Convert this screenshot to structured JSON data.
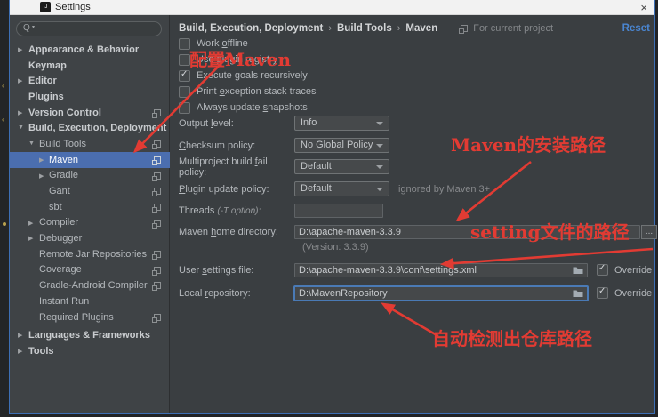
{
  "window": {
    "title": "Settings",
    "close_glyph": "×",
    "app_icon_text": "IJ"
  },
  "search": {
    "icon": "Q",
    "caret": "▾"
  },
  "sidebar": {
    "items": [
      {
        "arrow": "▶",
        "label": "Appearance & Behavior"
      },
      {
        "arrow": "",
        "label": "Keymap"
      },
      {
        "arrow": "▶",
        "label": "Editor"
      },
      {
        "arrow": "",
        "label": "Plugins"
      },
      {
        "arrow": "▶",
        "label": "Version Control"
      },
      {
        "arrow": "▼",
        "label": "Build, Execution, Deployment"
      },
      {
        "arrow": "▼",
        "label": "Build Tools"
      },
      {
        "arrow": "▶",
        "label": "Maven"
      },
      {
        "arrow": "▶",
        "label": "Gradle"
      },
      {
        "arrow": "",
        "label": "Gant"
      },
      {
        "arrow": "",
        "label": "sbt"
      },
      {
        "arrow": "▶",
        "label": "Compiler"
      },
      {
        "arrow": "▶",
        "label": "Debugger"
      },
      {
        "arrow": "",
        "label": "Remote Jar Repositories"
      },
      {
        "arrow": "",
        "label": "Coverage"
      },
      {
        "arrow": "",
        "label": "Gradle-Android Compiler"
      },
      {
        "arrow": "",
        "label": "Instant Run"
      },
      {
        "arrow": "",
        "label": "Required Plugins"
      },
      {
        "arrow": "▶",
        "label": "Languages & Frameworks"
      },
      {
        "arrow": "▶",
        "label": "Tools"
      }
    ]
  },
  "breadcrumb": {
    "seg1": "Build, Execution, Deployment",
    "seg2": "Build Tools",
    "seg3": "Maven",
    "separator": "›",
    "scope_label": "For current project",
    "reset_label": "Reset"
  },
  "checkboxes": [
    {
      "pre": "Work ",
      "u": "o",
      "post": "ffline",
      "check": ""
    },
    {
      "pre": "Use plugin registry",
      "u": "",
      "post": "",
      "check": ""
    },
    {
      "pre": "Execute ",
      "u": "g",
      "post": "oals recursively",
      "check": "✓"
    },
    {
      "pre": "Print ",
      "u": "e",
      "post": "xception stack traces",
      "check": ""
    },
    {
      "pre": "Always update ",
      "u": "s",
      "post": "napshots",
      "check": ""
    }
  ],
  "form": {
    "output_level": {
      "pre": "Output ",
      "u": "l",
      "post": "evel:",
      "value": "Info"
    },
    "checksum": {
      "pre": "",
      "u": "C",
      "post": "hecksum policy:",
      "value": "No Global Policy"
    },
    "multiproject": {
      "pre": "Multiproject build ",
      "u": "f",
      "post": "ail policy:",
      "value": "Default"
    },
    "plugin_update": {
      "pre": "",
      "u": "P",
      "post": "lugin update policy:",
      "value": "Default",
      "note": "ignored by Maven 3+"
    },
    "threads": {
      "label": "Threads",
      "hint": "(-T option):",
      "value": ""
    },
    "maven_home": {
      "pre": "Maven ",
      "u": "h",
      "post": "ome directory:",
      "value": "D:\\apache-maven-3.3.9",
      "browse": "...",
      "version_note": "(Version: 3.3.9)"
    },
    "user_settings": {
      "pre": "User ",
      "u": "s",
      "post": "ettings file:",
      "value": "D:\\apache-maven-3.3.9\\conf\\settings.xml",
      "override_label": "Override",
      "override_check": "✓"
    },
    "local_repository": {
      "pre": "Local ",
      "u": "r",
      "post": "epository:",
      "value": "D:\\MavenRepository",
      "override_label": "Override",
      "override_check": "✓"
    }
  },
  "annotations": {
    "color": "#e23b33",
    "items": [
      {
        "text": "配置Maven"
      },
      {
        "text": "Maven的安装路径"
      },
      {
        "text": "setting文件的路径"
      },
      {
        "text": "自动检测出仓库路径"
      }
    ]
  },
  "colors": {
    "selection_blue": "#4b6eaf",
    "dialog_border_blue": "#3d6fb5",
    "panel_bg": "#3a3e41",
    "sidebar_bg": "#3f4346",
    "reset_link": "#4a86d2"
  }
}
